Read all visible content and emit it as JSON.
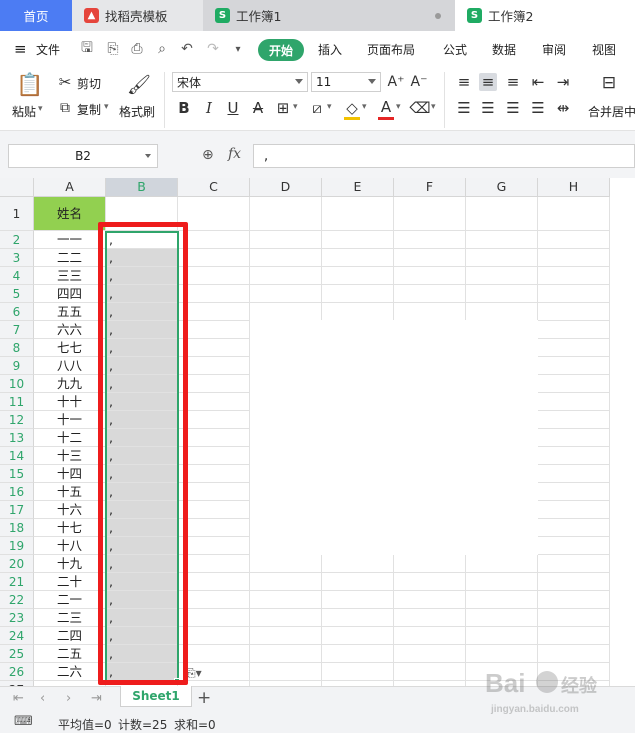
{
  "tabs": [
    {
      "label": "首页"
    },
    {
      "label": "找稻壳模板",
      "icon": "docer-icon"
    },
    {
      "label": "工作簿1",
      "icon": "spreadsheet-icon"
    },
    {
      "label": "工作簿2",
      "icon": "spreadsheet-icon"
    }
  ],
  "menu": {
    "file": "文件",
    "items": [
      "开始",
      "插入",
      "页面布局",
      "公式",
      "数据",
      "审阅",
      "视图"
    ]
  },
  "ribbon": {
    "paste": "粘贴",
    "cut": "剪切",
    "copy": "复制",
    "format_painter": "格式刷",
    "font_name": "宋体",
    "font_size": "11",
    "merge_center": "合并居中"
  },
  "formula_bar": {
    "name_box": "B2",
    "fx": "fx",
    "content": ","
  },
  "columns": [
    "A",
    "B",
    "C",
    "D",
    "E",
    "F",
    "G",
    "H"
  ],
  "active_column": "B",
  "header_row": {
    "row": "1",
    "a": "姓名",
    "b": ""
  },
  "rows": [
    {
      "n": "2",
      "a": "一一",
      "b": ","
    },
    {
      "n": "3",
      "a": "二二",
      "b": ","
    },
    {
      "n": "4",
      "a": "三三",
      "b": ","
    },
    {
      "n": "5",
      "a": "四四",
      "b": ","
    },
    {
      "n": "6",
      "a": "五五",
      "b": ","
    },
    {
      "n": "7",
      "a": "六六",
      "b": ","
    },
    {
      "n": "8",
      "a": "七七",
      "b": ","
    },
    {
      "n": "9",
      "a": "八八",
      "b": ","
    },
    {
      "n": "10",
      "a": "九九",
      "b": ","
    },
    {
      "n": "11",
      "a": "十十",
      "b": ","
    },
    {
      "n": "12",
      "a": "十一",
      "b": ","
    },
    {
      "n": "13",
      "a": "十二",
      "b": ","
    },
    {
      "n": "14",
      "a": "十三",
      "b": ","
    },
    {
      "n": "15",
      "a": "十四",
      "b": ","
    },
    {
      "n": "16",
      "a": "十五",
      "b": ","
    },
    {
      "n": "17",
      "a": "十六",
      "b": ","
    },
    {
      "n": "18",
      "a": "十七",
      "b": ","
    },
    {
      "n": "19",
      "a": "十八",
      "b": ","
    },
    {
      "n": "20",
      "a": "十九",
      "b": ","
    },
    {
      "n": "21",
      "a": "二十",
      "b": ","
    },
    {
      "n": "22",
      "a": "二一",
      "b": ","
    },
    {
      "n": "23",
      "a": "二三",
      "b": ","
    },
    {
      "n": "24",
      "a": "二四",
      "b": ","
    },
    {
      "n": "25",
      "a": "二五",
      "b": ","
    },
    {
      "n": "26",
      "a": "二六",
      "b": ","
    },
    {
      "n": "27",
      "a": "",
      "b": ""
    }
  ],
  "sheet_tab": "Sheet1",
  "status": {
    "average": "平均值=0",
    "count": "计数=25",
    "sum": "求和=0"
  },
  "watermark": "Baidu经验",
  "colors": {
    "accent_green": "#2fa56b",
    "home_tab_blue": "#4c7cf3",
    "header_fill": "#92d050",
    "annotation_red": "#ee1c1c"
  }
}
